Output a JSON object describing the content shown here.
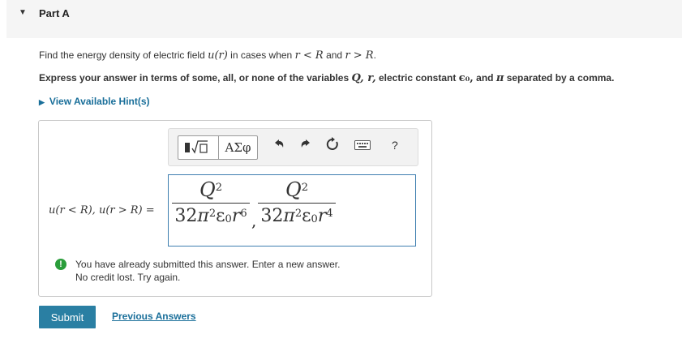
{
  "part": {
    "title": "Part A"
  },
  "question": {
    "prefix": "Find the energy density of electric field ",
    "ur": "u(r)",
    "mid": " in cases when ",
    "cond1": "r < R",
    "and": " and ",
    "cond2": "r > R",
    "end": "."
  },
  "express": {
    "prefix": "Express your answer in terms of some, all, or none of the variables ",
    "vars": "Q, r,",
    "mid": " electric constant ",
    "eps": "ϵ₀,",
    "and": " and ",
    "pi": "π",
    "suffix": " separated by a comma."
  },
  "hint": {
    "label": "View Available Hint(s)"
  },
  "toolbar": {
    "templates_label": "▮√▯",
    "greek_label": "ΑΣφ"
  },
  "answer": {
    "label": "u(r < R), u(r > R) =",
    "frac1": {
      "num": "Q",
      "num_exp": "2",
      "coef": "32",
      "pi_exp": "2",
      "eps": "ε",
      "eps_sub": "0",
      "r_exp": "6"
    },
    "frac2": {
      "num": "Q",
      "num_exp": "2",
      "coef": "32",
      "pi_exp": "2",
      "eps": "ε",
      "eps_sub": "0",
      "r_exp": "4"
    },
    "separator": ","
  },
  "feedback": {
    "icon": "!",
    "line1": "You have already submitted this answer. Enter a new answer.",
    "line2": "No credit lost. Try again."
  },
  "actions": {
    "submit": "Submit",
    "previous": "Previous Answers"
  },
  "colors": {
    "accent": "#2a7fa3",
    "link": "#1a6f9a",
    "feedback_green": "#2a9d3a"
  }
}
